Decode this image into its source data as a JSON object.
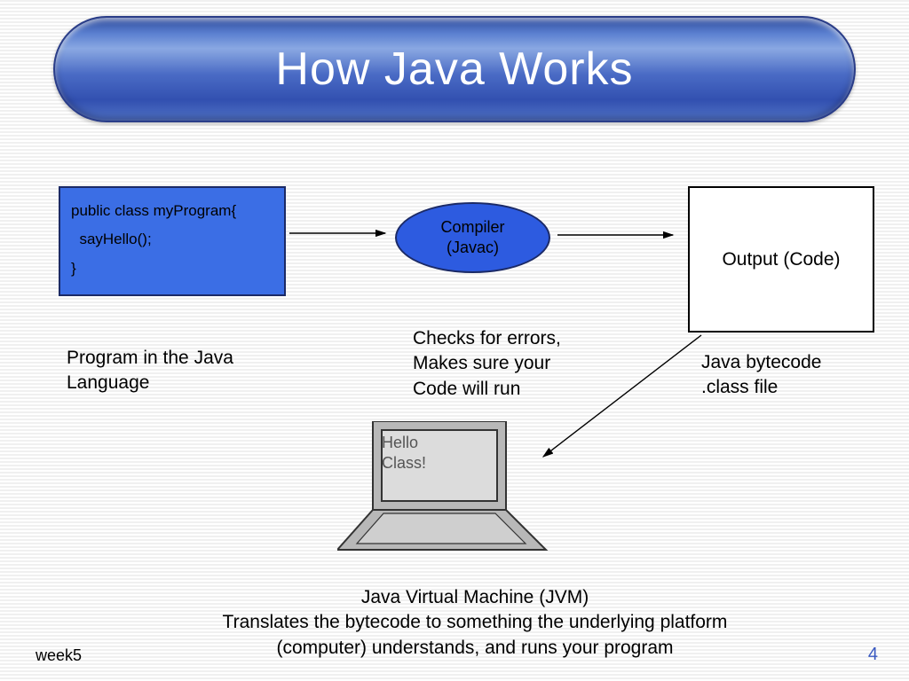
{
  "title": "How Java Works",
  "code_box": {
    "line1": "public class myProgram{",
    "line2": "  sayHello();",
    "line3": "}"
  },
  "compiler": {
    "line1": "Compiler",
    "line2": "(Javac)"
  },
  "output_box": "Output (Code)",
  "captions": {
    "program": "Program in the Java\nLanguage",
    "compiler_desc": "Checks for errors,\nMakes sure your\nCode will run",
    "bytecode": "Java bytecode\n.class file"
  },
  "laptop_screen": {
    "line1": "Hello",
    "line2": "Class!"
  },
  "jvm_caption": "Java Virtual Machine (JVM)\nTranslates the bytecode to something the underlying platform (computer) understands, and runs your program",
  "footer": {
    "left": "week5",
    "right": "4"
  },
  "colors": {
    "pill_gradient_top": "#5a7fd0",
    "pill_gradient_bottom": "#3250b0",
    "box_blue": "#3b6ee5",
    "ellipse_blue": "#2d5be0",
    "page_number": "#3858c0"
  }
}
